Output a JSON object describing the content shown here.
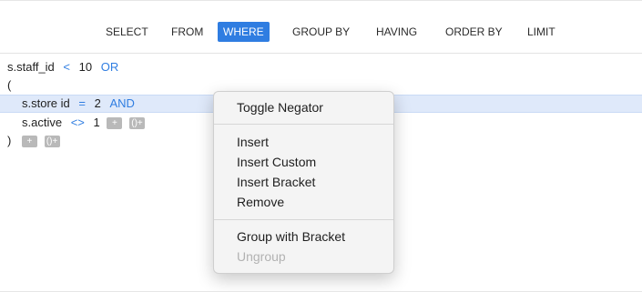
{
  "tabs": [
    {
      "label": "SELECT",
      "active": false
    },
    {
      "label": "FROM",
      "active": false
    },
    {
      "label": "WHERE",
      "active": true
    },
    {
      "label": "GROUP BY",
      "active": false
    },
    {
      "label": "HAVING",
      "active": false
    },
    {
      "label": "ORDER BY",
      "active": false
    },
    {
      "label": "LIMIT",
      "active": false
    }
  ],
  "editor": {
    "line1": {
      "field": "s.staff_id",
      "op": "<",
      "value": "10",
      "connector": "OR"
    },
    "line2": {
      "text": "("
    },
    "line3": {
      "field": "s.store id",
      "op": "=",
      "value": "2",
      "connector": "AND"
    },
    "line4": {
      "field": "s.active",
      "op": "<>",
      "value": "1",
      "add_label": "+",
      "bracket_label": "()+"
    },
    "line5": {
      "text": ")",
      "add_label": "+",
      "bracket_label": "()+"
    }
  },
  "context_menu": {
    "items": [
      {
        "label": "Toggle Negator",
        "enabled": true
      },
      {
        "label": "Insert",
        "enabled": true
      },
      {
        "label": "Insert Custom",
        "enabled": true
      },
      {
        "label": "Insert Bracket",
        "enabled": true
      },
      {
        "label": "Remove",
        "enabled": true
      },
      {
        "label": "Group with Bracket",
        "enabled": true
      },
      {
        "label": "Ungroup",
        "enabled": false
      }
    ]
  },
  "colors": {
    "accent": "#2f7de1",
    "highlight": "#dfe9fa",
    "menu_bg": "#f4f4f4"
  }
}
